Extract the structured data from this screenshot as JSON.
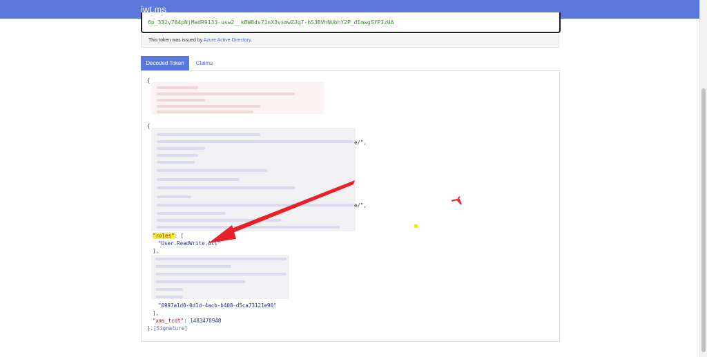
{
  "navbar": {
    "brand": "jwt.ms"
  },
  "token": {
    "tail": "6p_332v784pNjMadR9133-usw2__kBW8dv71nX3vsmwZJq7-hS38VhNUbhY2P_dImwgSfPIzUA"
  },
  "issued": {
    "prefix": "This token was issued by ",
    "link": "Azure Active Directory",
    "suffix": "."
  },
  "tabs": [
    {
      "label": "Decoded Token",
      "active": true
    },
    {
      "label": "Claims",
      "active": false
    }
  ],
  "decoded": {
    "open_brace_1": "{",
    "open_brace_2": "{",
    "suffix_1": "e/\",",
    "suffix_2": "e/\",",
    "roles_key": "\"roles\"",
    "roles_tail": ": [",
    "roles_value": "\"User.ReadWrite.All\"",
    "roles_close": "],",
    "wids_value": "\"0997a1d0-0d1d-4acb-b408-d5ca73121e90\"",
    "wids_close": "],",
    "xms_key": "\"xms_tcdt\"",
    "xms_value": "1483478948",
    "close_prefix": "}.",
    "signature": "[Signature]"
  },
  "colors": {
    "navbar": "#5a78dc",
    "tab_active": "#5a78dc",
    "link": "#4a6cd4",
    "highlight": "#f8f03a",
    "annotation_arrow": "#e8202a"
  },
  "icons": [
    "red-arrow-annotation",
    "red-mark-annotation",
    "yellow-dot-annotation"
  ]
}
